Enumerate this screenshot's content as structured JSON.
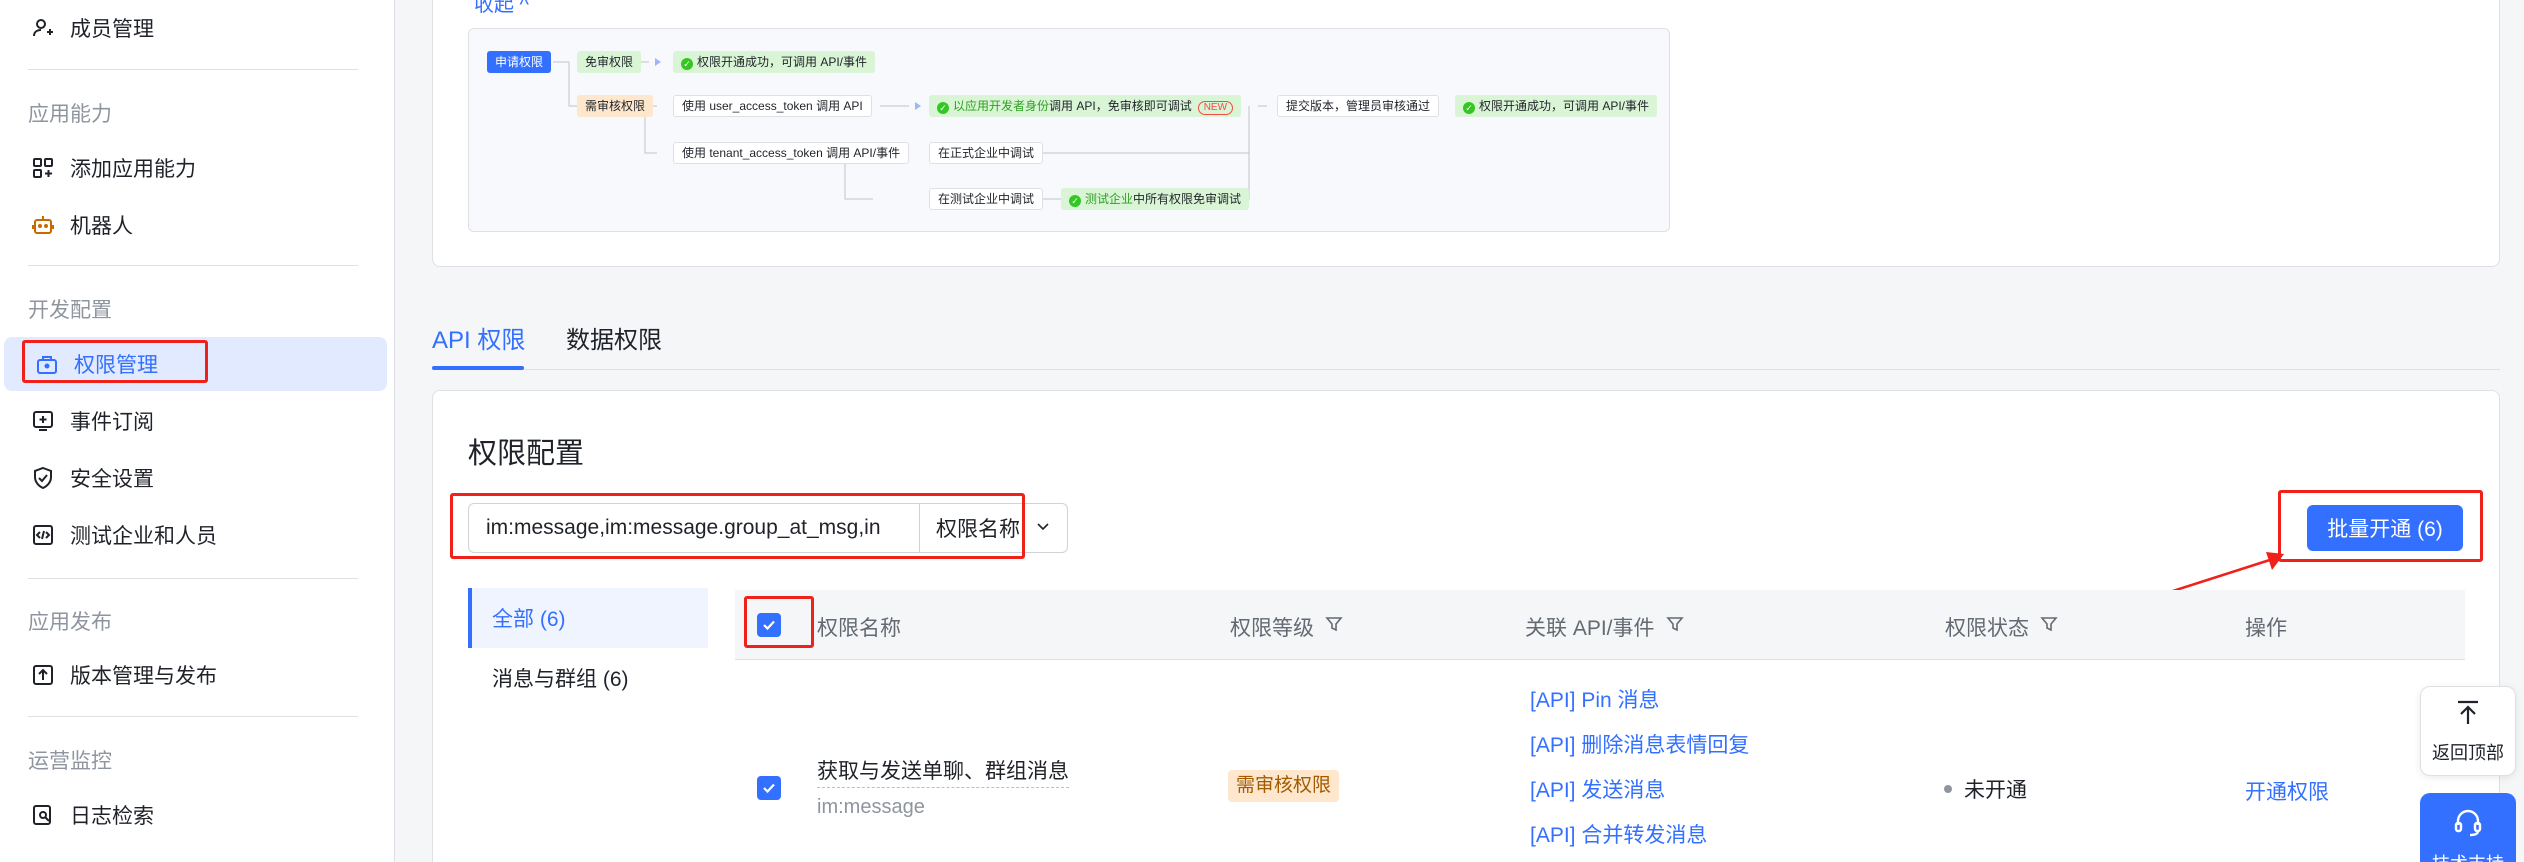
{
  "sidebar": {
    "items_top": [
      {
        "label": "成员管理",
        "icon": "user-icon"
      }
    ],
    "groups": [
      {
        "title": "应用能力",
        "items": [
          {
            "label": "添加应用能力",
            "icon": "grid-plus-icon"
          },
          {
            "label": "机器人",
            "icon": "robot-icon"
          }
        ]
      },
      {
        "title": "开发配置",
        "items": [
          {
            "label": "权限管理",
            "icon": "lock-bag-icon"
          },
          {
            "label": "事件订阅",
            "icon": "event-plus-icon"
          },
          {
            "label": "安全设置",
            "icon": "shield-check-icon"
          },
          {
            "label": "测试企业和人员",
            "icon": "code-box-icon"
          }
        ]
      },
      {
        "title": "应用发布",
        "items": [
          {
            "label": "版本管理与发布",
            "icon": "upload-box-icon"
          }
        ]
      },
      {
        "title": "运营监控",
        "items": [
          {
            "label": "日志检索",
            "icon": "log-search-icon"
          }
        ]
      }
    ],
    "active": "权限管理"
  },
  "top_card": {
    "collapse_link": "收起",
    "flow": {
      "apply": "申请权限",
      "no_review": "免审权限",
      "success_direct": "权限开通成功，可调用 API/事件",
      "need_review": "需审核权限",
      "use_user_token": "使用 user_access_token 调用 API",
      "as_developer_prefix": "以应用开发者身份",
      "as_developer_suffix": "调用 API，免审核即可调试",
      "new_badge": "NEW",
      "submit_version": "提交版本，管理员审核通过",
      "success_final": "权限开通成功，可调用 API/事件",
      "use_tenant_token": "使用 tenant_access_token 调用 API/事件",
      "debug_prod": "在正式企业中调试",
      "debug_test": "在测试企业中调试",
      "test_company_prefix": "测试企业",
      "test_company_suffix": "中所有权限免审调试"
    }
  },
  "tabs": [
    {
      "label": "API 权限"
    },
    {
      "label": "数据权限"
    }
  ],
  "section": {
    "title": "权限配置",
    "search": {
      "value": "im:message,im:message.group_at_msg,in",
      "field": "权限名称"
    },
    "batch_button": "批量开通 (6)"
  },
  "categories": [
    {
      "label": "全部 (6)",
      "active": true
    },
    {
      "label": "消息与群组 (6)",
      "active": false
    }
  ],
  "table": {
    "headers": {
      "name": "权限名称",
      "level": "权限等级",
      "api": "关联 API/事件",
      "status": "权限状态",
      "action": "操作"
    },
    "rows": [
      {
        "name": "获取与发送单聊、群组消息",
        "code": "im:message",
        "level": "需审核权限",
        "apis": [
          "[API] Pin 消息",
          "[API] 删除消息表情回复",
          "[API] 发送消息",
          "[API] 合并转发消息"
        ],
        "status": "未开通",
        "action": "开通权限",
        "checked": true
      }
    ]
  },
  "float": {
    "back_to_top": "返回顶部",
    "support": "技术支持"
  },
  "colors": {
    "accent": "#3370ff",
    "annotation": "#f0201a",
    "review_tag_bg": "#fee7cd"
  }
}
